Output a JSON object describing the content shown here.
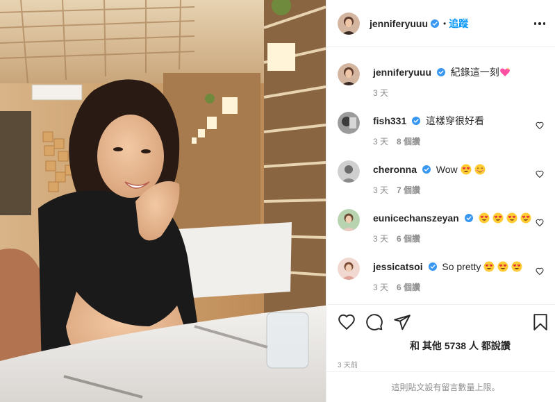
{
  "post": {
    "author": "jenniferyuuu",
    "follow_label": "追蹤",
    "separator": "•",
    "caption": {
      "username": "jenniferyuuu",
      "text": "紀錄這一刻",
      "time": "3 天"
    },
    "comments": [
      {
        "username": "fish331",
        "text": "這樣穿很好看",
        "time": "3 天",
        "likes": "8 個讚"
      },
      {
        "username": "cheronna",
        "text": "Wow",
        "time": "3 天",
        "likes": "7 個讚"
      },
      {
        "username": "eunicechanszeyan",
        "text": "",
        "time": "3 天",
        "likes": "6 個讚"
      },
      {
        "username": "jessicatsoi",
        "text": "So pretty",
        "time": "3 天",
        "likes": "6 個讚"
      }
    ],
    "likes": {
      "prefix": "和 其他",
      "count": "5738",
      "suffix": "人 都說讚"
    },
    "timestamp": "3 天前",
    "comments_limit_notice": "這則貼文設有留言數量上限。"
  },
  "colors": {
    "link_blue": "#0095f6",
    "verified_blue": "#3897f0",
    "text_primary": "#262626",
    "text_secondary": "#8e8e8e",
    "divider": "#efefef"
  },
  "icons": {
    "verified": "verified-badge-icon",
    "more": "more-options-icon",
    "like": "heart-icon",
    "comment": "comment-icon",
    "share": "paper-plane-icon",
    "save": "bookmark-icon",
    "emoji_heart": "sparkling-heart-emoji",
    "emoji_heart_eyes": "heart-eyes-emoji",
    "emoji_blush": "smiling-face-emoji"
  }
}
